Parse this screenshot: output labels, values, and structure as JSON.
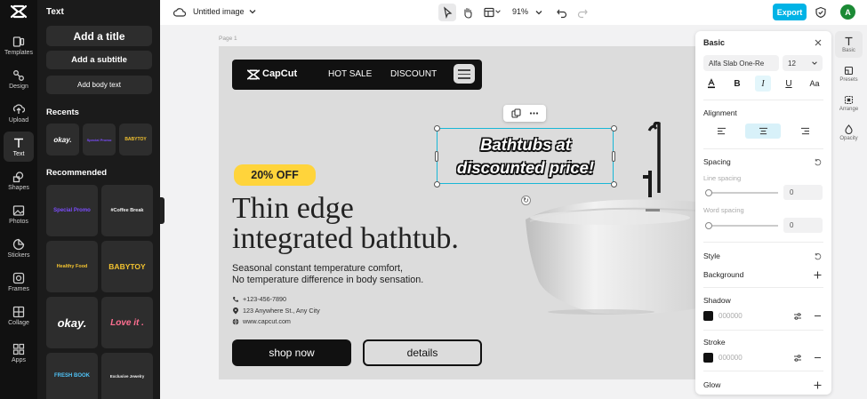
{
  "rail": {
    "items": [
      {
        "label": "Templates",
        "icon": "templates-icon"
      },
      {
        "label": "Design",
        "icon": "design-icon"
      },
      {
        "label": "Upload",
        "icon": "upload-icon"
      },
      {
        "label": "Text",
        "icon": "text-icon",
        "active": true
      },
      {
        "label": "Shapes",
        "icon": "shapes-icon"
      },
      {
        "label": "Photos",
        "icon": "photos-icon"
      },
      {
        "label": "Stickers",
        "icon": "stickers-icon"
      },
      {
        "label": "Frames",
        "icon": "frames-icon"
      },
      {
        "label": "Collage",
        "icon": "collage-icon"
      },
      {
        "label": "Apps",
        "icon": "apps-icon"
      }
    ]
  },
  "panel": {
    "title": "Text",
    "add_title": "Add a title",
    "add_subtitle": "Add a subtitle",
    "add_body": "Add body text",
    "recents_title": "Recents",
    "recents": [
      {
        "text": "okay.",
        "color": "#ffffff"
      },
      {
        "text": "Special Promo",
        "color": "#7c4dff"
      },
      {
        "text": "BABYTOY",
        "color": "#f2c230"
      }
    ],
    "recommended_title": "Recommended",
    "recommended": [
      {
        "text": "Special Promo",
        "color": "#7c4dff"
      },
      {
        "text": "#Coffee Break",
        "color": "#f1f1f1"
      },
      {
        "text": "Healthy Food",
        "color": "#f2c230"
      },
      {
        "text": "BABYTOY",
        "color": "#f2c230"
      },
      {
        "text": "okay.",
        "color": "#ffffff"
      },
      {
        "text": "Love it .",
        "color": "#ff6f91"
      },
      {
        "text": "FRESH BOOK",
        "color": "#4fc3f7"
      },
      {
        "text": "Exclusive Jewelry",
        "color": "#f1f1f1"
      }
    ]
  },
  "topbar": {
    "doc_title": "Untitled image",
    "zoom": "91%",
    "export": "Export",
    "avatar": "A"
  },
  "canvas": {
    "page_label": "Page 1",
    "brand": "CapCut",
    "nav_links": [
      "HOT SALE",
      "DISCOUNT"
    ],
    "badge": "20% OFF",
    "headline_1": "Thin edge",
    "headline_2": "integrated bathtub.",
    "sub_1": "Seasonal constant temperature comfort,",
    "sub_2": "No temperature difference in body sensation.",
    "phone": "+123-456-7890",
    "address": "123 Anywhere St., Any City",
    "website": "www.capcut.com",
    "shop_button": "shop now",
    "details_button": "details",
    "promo_1": "Bathtubs at",
    "promo_2": "discounted price!"
  },
  "props": {
    "title": "Basic",
    "font": "Alfa Slab One-Re",
    "size": "12",
    "alignment_title": "Alignment",
    "spacing_title": "Spacing",
    "line_spacing": "Line spacing",
    "line_value": "0",
    "word_spacing": "Word spacing",
    "word_value": "0",
    "style_title": "Style",
    "background": "Background",
    "shadow": "Shadow",
    "shadow_hex": "000000",
    "stroke": "Stroke",
    "stroke_hex": "000000",
    "glow": "Glow"
  },
  "tabs": {
    "basic": "Basic",
    "presets": "Presets",
    "arrange": "Arrange",
    "opacity": "Opacity"
  },
  "colors": {
    "accent": "#00b3e6",
    "selection": "#19b7d6",
    "badge": "#ffd43b"
  }
}
